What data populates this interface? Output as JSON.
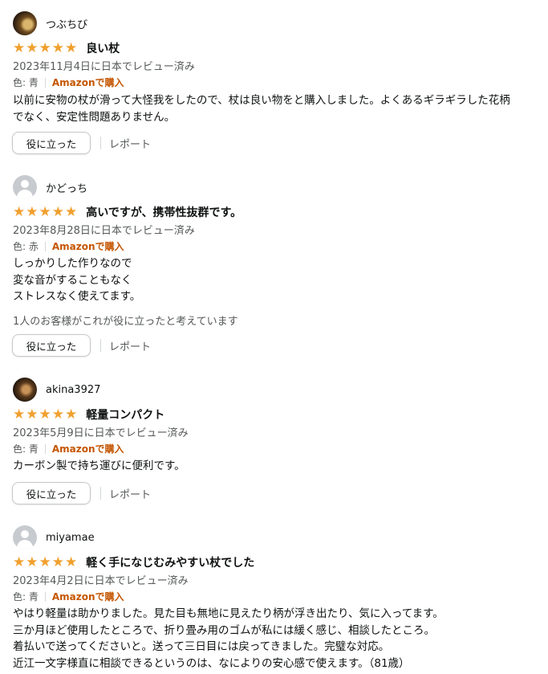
{
  "reviews": [
    {
      "name": "つぶちび",
      "stars": [
        "★",
        "★",
        "★",
        "★",
        "★"
      ],
      "title": "良い杖",
      "date": "2023年11月4日に日本でレビュー済み",
      "color": "色: 青",
      "verified": "Amazonで購入",
      "body": [
        "以前に安物の杖が滑って大怪我をしたので、杖は良い物をと購入しました。よくあるギラギラした花柄",
        "でなく、安定性問題ありません。"
      ],
      "helpful_count": "",
      "helpful_label": "役に立った",
      "report_label": "レポート"
    },
    {
      "name": "かどっち",
      "stars": [
        "★",
        "★",
        "★",
        "★",
        "★"
      ],
      "title": "高いですが、携帯性抜群です。",
      "date": "2023年8月28日に日本でレビュー済み",
      "color": "色: 赤",
      "verified": "Amazonで購入",
      "body": [
        "しっかりした作りなので",
        "変な音がすることもなく",
        "ストレスなく使えてます。"
      ],
      "helpful_count": "1人のお客様がこれが役に立ったと考えています",
      "helpful_label": "役に立った",
      "report_label": "レポート"
    },
    {
      "name": "akina3927",
      "stars": [
        "★",
        "★",
        "★",
        "★",
        "★"
      ],
      "title": "軽量コンパクト",
      "date": "2023年5月9日に日本でレビュー済み",
      "color": "色: 青",
      "verified": "Amazonで購入",
      "body": [
        "カーボン製で持ち運びに便利です。"
      ],
      "helpful_count": "",
      "helpful_label": "役に立った",
      "report_label": "レポート"
    },
    {
      "name": "miyamae",
      "stars": [
        "★",
        "★",
        "★",
        "★",
        "★"
      ],
      "title": "軽く手になじむみやすい杖でした",
      "date": "2023年4月2日に日本でレビュー済み",
      "color": "色: 青",
      "verified": "Amazonで購入",
      "body": [
        "やはり軽量は助かりました。見た目も無地に見えたり柄が浮き出たり、気に入ってます。",
        "三か月ほど使用したところで、折り畳み用のゴムが私には緩く感じ、相談したところ。",
        "着払いで送ってくださいと。送って三日目には戻ってきました。完璧な対応。",
        "近江一文字様直に相談できるというのは、なによりの安心感で使えます。（81歳）"
      ],
      "helpful_count": "",
      "helpful_label": "",
      "report_label": ""
    }
  ]
}
